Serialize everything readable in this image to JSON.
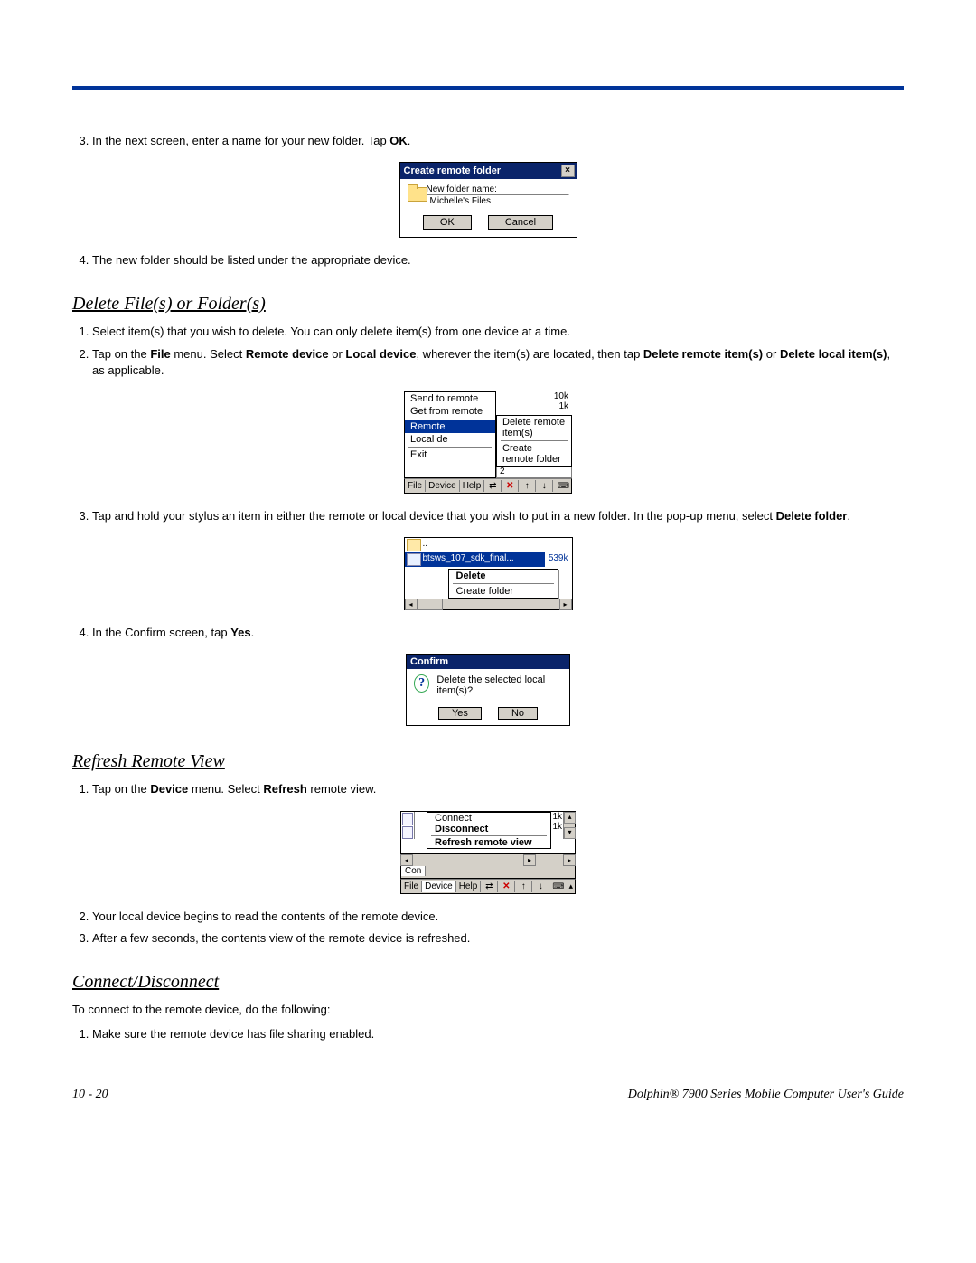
{
  "step3_prefix": "In the next screen, enter a name for your new folder. Tap ",
  "step3_bold": "OK",
  "step3_suffix": ".",
  "dlg_create": {
    "title": "Create remote folder",
    "label": "New folder name:",
    "value": "Michelle's Files",
    "ok": "OK",
    "cancel": "Cancel"
  },
  "step4": "The new folder should be listed under the appropriate device.",
  "h_delete": "Delete File(s) or Folder(s)",
  "del_1": "Select item(s) that you wish to delete. You can only delete item(s) from one device at a time.",
  "del_2a": "Tap on the ",
  "del_2b": "File",
  "del_2c": " menu. Select ",
  "del_2d": "Remote device",
  "del_2e": " or ",
  "del_2f": "Local device",
  "del_2g": ", wherever the item(s) are located, then tap ",
  "del_2h": "Delete remote item(s)",
  "del_2i": " or ",
  "del_2j": "Delete local item(s)",
  "del_2k": ", as applicable.",
  "filemenu": {
    "send": "Send to remote",
    "get": "Get from remote",
    "remote": "Remote",
    "local": "Local de",
    "exit": "Exit",
    "sub_del": "Delete remote item(s)",
    "sub_create": "Create remote folder",
    "size1": "10k",
    "size2": "1k",
    "tb_file": "File",
    "tb_device": "Device",
    "tb_help": "Help"
  },
  "del_3a": "Tap and hold your stylus an item in either the remote or local device that you wish to put in a new folder. In the pop-up menu, select ",
  "del_3b": "Delete folder",
  "del_3c": ".",
  "ctx": {
    "dotdot": "..",
    "file": "btsws_107_sdk_final...",
    "size": "539k",
    "m_delete": "Delete",
    "m_create": "Create folder"
  },
  "del_4a": "In the Confirm screen, tap ",
  "del_4b": "Yes",
  "del_4c": ".",
  "confirm": {
    "title": "Confirm",
    "msg": "Delete the selected local item(s)?",
    "yes": "Yes",
    "no": "No"
  },
  "h_refresh": "Refresh Remote View",
  "ref_1a": "Tap on the ",
  "ref_1b": "Device",
  "ref_1c": " menu. Select ",
  "ref_1d": "Refresh",
  "ref_1e": " remote view.",
  "devmenu": {
    "connect": "Connect",
    "disconnect": "Disconnect",
    "refresh": "Refresh remote view",
    "s1": "1k",
    "s2": "1k",
    "con": "Con",
    "tb_file": "File",
    "tb_device": "Device",
    "tb_help": "Help"
  },
  "ref_2": "Your local device begins to read the contents of the remote device.",
  "ref_3": "After a few seconds, the contents view of the remote device is refreshed.",
  "h_cd": "Connect/Disconnect",
  "cd_intro": "To connect to the remote device, do the following:",
  "cd_1": "Make sure the remote device has file sharing enabled.",
  "foot_left": "10 - 20",
  "foot_right": "Dolphin® 7900 Series Mobile Computer User's Guide"
}
